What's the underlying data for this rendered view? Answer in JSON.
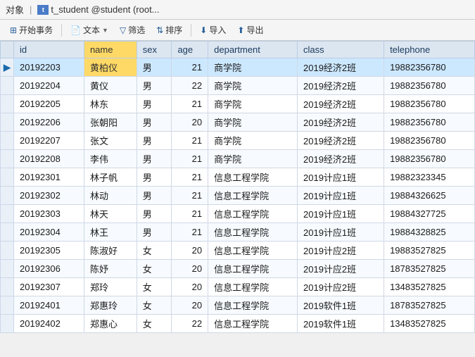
{
  "titlebar": {
    "left_label": "对象",
    "icon_label": "t",
    "table_title": "t_student @student (root..."
  },
  "toolbar": {
    "begin_transaction": "开始事务",
    "text_btn": "文本",
    "filter_btn": "筛选",
    "sort_btn": "排序",
    "import_btn": "导入",
    "export_btn": "导出"
  },
  "table": {
    "columns": [
      "id",
      "name",
      "sex",
      "age",
      "department",
      "class",
      "telephone"
    ],
    "rows": [
      {
        "id": "20192203",
        "name": "黄柏仪",
        "sex": "男",
        "age": "21",
        "department": "商学院",
        "class": "2019经济2班",
        "telephone": "19882356780",
        "selected": true
      },
      {
        "id": "20192204",
        "name": "黄仪",
        "sex": "男",
        "age": "22",
        "department": "商学院",
        "class": "2019经济2班",
        "telephone": "19882356780",
        "selected": false
      },
      {
        "id": "20192205",
        "name": "林东",
        "sex": "男",
        "age": "21",
        "department": "商学院",
        "class": "2019经济2班",
        "telephone": "19882356780",
        "selected": false
      },
      {
        "id": "20192206",
        "name": "张朝阳",
        "sex": "男",
        "age": "20",
        "department": "商学院",
        "class": "2019经济2班",
        "telephone": "19882356780",
        "selected": false
      },
      {
        "id": "20192207",
        "name": "张文",
        "sex": "男",
        "age": "21",
        "department": "商学院",
        "class": "2019经济2班",
        "telephone": "19882356780",
        "selected": false
      },
      {
        "id": "20192208",
        "name": "李伟",
        "sex": "男",
        "age": "21",
        "department": "商学院",
        "class": "2019经济2班",
        "telephone": "19882356780",
        "selected": false
      },
      {
        "id": "20192301",
        "name": "林子帆",
        "sex": "男",
        "age": "21",
        "department": "信息工程学院",
        "class": "2019计应1班",
        "telephone": "19882323345",
        "selected": false
      },
      {
        "id": "20192302",
        "name": "林动",
        "sex": "男",
        "age": "21",
        "department": "信息工程学院",
        "class": "2019计应1班",
        "telephone": "19884326625",
        "selected": false
      },
      {
        "id": "20192303",
        "name": "林天",
        "sex": "男",
        "age": "21",
        "department": "信息工程学院",
        "class": "2019计应1班",
        "telephone": "19884327725",
        "selected": false
      },
      {
        "id": "20192304",
        "name": "林王",
        "sex": "男",
        "age": "21",
        "department": "信息工程学院",
        "class": "2019计应1班",
        "telephone": "19884328825",
        "selected": false
      },
      {
        "id": "20192305",
        "name": "陈淑好",
        "sex": "女",
        "age": "20",
        "department": "信息工程学院",
        "class": "2019计应2班",
        "telephone": "19883527825",
        "selected": false
      },
      {
        "id": "20192306",
        "name": "陈妤",
        "sex": "女",
        "age": "20",
        "department": "信息工程学院",
        "class": "2019计应2班",
        "telephone": "18783527825",
        "selected": false
      },
      {
        "id": "20192307",
        "name": "郑玲",
        "sex": "女",
        "age": "20",
        "department": "信息工程学院",
        "class": "2019计应2班",
        "telephone": "13483527825",
        "selected": false
      },
      {
        "id": "20192401",
        "name": "郑惠玲",
        "sex": "女",
        "age": "20",
        "department": "信息工程学院",
        "class": "2019软件1班",
        "telephone": "18783527825",
        "selected": false
      },
      {
        "id": "20192402",
        "name": "郑惠心",
        "sex": "女",
        "age": "22",
        "department": "信息工程学院",
        "class": "2019软件1班",
        "telephone": "13483527825",
        "selected": false
      }
    ]
  }
}
